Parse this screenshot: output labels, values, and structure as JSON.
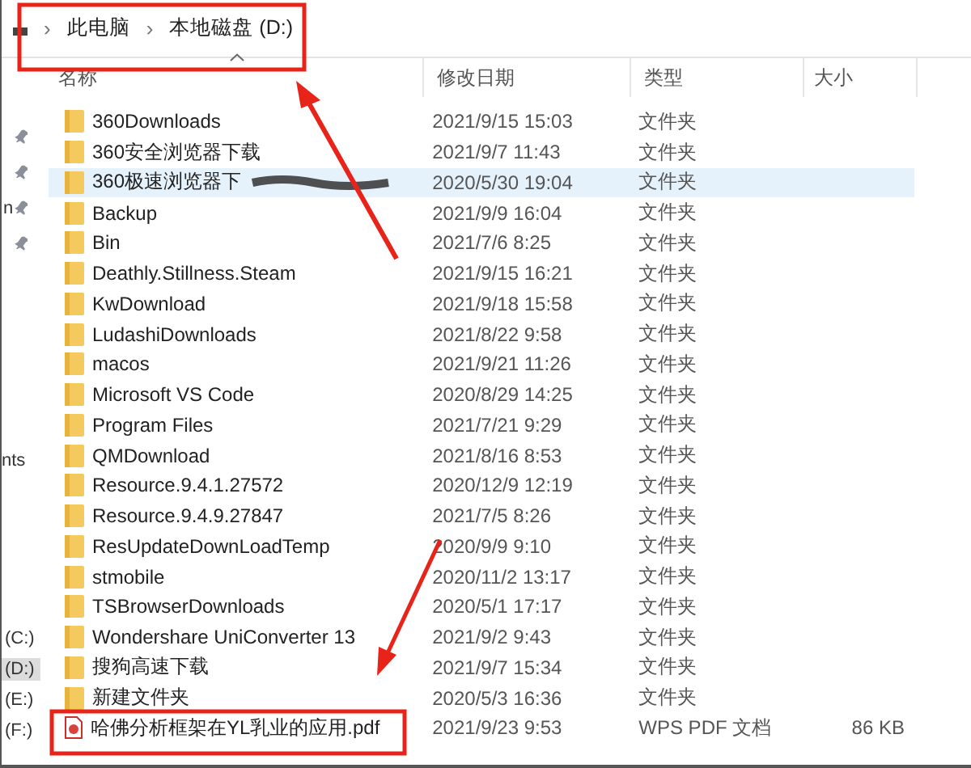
{
  "breadcrumb": [
    {
      "kind": "separator",
      "text": "›"
    },
    {
      "kind": "crumb",
      "text": "此电脑"
    },
    {
      "kind": "separator",
      "text": "›"
    },
    {
      "kind": "crumb",
      "text": "本地磁盘 (D:)"
    }
  ],
  "sidebar": {
    "quick_access": [
      {
        "pinned": true
      },
      {
        "pinned": true
      },
      {
        "pinned": true,
        "text": "n"
      },
      {
        "pinned": true
      }
    ],
    "label": "nts",
    "drives": [
      {
        "label": "(C:)",
        "selected": false
      },
      {
        "label": "(D:)",
        "selected": true
      },
      {
        "label": "(E:)",
        "selected": false
      },
      {
        "label": "(F:)",
        "selected": false
      }
    ]
  },
  "table": {
    "columns": [
      "名称",
      "修改日期",
      "类型",
      "大小"
    ],
    "rows": [
      {
        "kind": "folder",
        "name": "360Downloads",
        "date": "2021/9/15 15:03",
        "type": "文件夹",
        "selected": false
      },
      {
        "kind": "folder",
        "name": "360安全浏览器下载",
        "date": "2021/9/7 11:43",
        "type": "文件夹",
        "selected": false
      },
      {
        "kind": "folder",
        "name": "360极速浏览器下",
        "redacted": true,
        "date": "2020/5/30 19:04",
        "type": "文件夹",
        "selected": true
      },
      {
        "kind": "folder",
        "name": "Backup",
        "date": "2021/9/9 16:04",
        "type": "文件夹",
        "selected": false
      },
      {
        "kind": "folder",
        "name": "Bin",
        "date": "2021/7/6 8:25",
        "type": "文件夹",
        "selected": false
      },
      {
        "kind": "folder",
        "name": "Deathly.Stillness.Steam",
        "date": "2021/9/15 16:21",
        "type": "文件夹",
        "selected": false
      },
      {
        "kind": "folder",
        "name": "KwDownload",
        "date": "2021/9/18 15:58",
        "type": "文件夹",
        "selected": false
      },
      {
        "kind": "folder",
        "name": "LudashiDownloads",
        "date": "2021/8/22 9:58",
        "type": "文件夹",
        "selected": false
      },
      {
        "kind": "folder",
        "name": "macos",
        "date": "2021/9/21 11:26",
        "type": "文件夹",
        "selected": false
      },
      {
        "kind": "folder",
        "name": "Microsoft VS Code",
        "date": "2020/8/29 14:25",
        "type": "文件夹",
        "selected": false
      },
      {
        "kind": "folder",
        "name": "Program Files",
        "date": "2021/7/21 9:29",
        "type": "文件夹",
        "selected": false
      },
      {
        "kind": "folder",
        "name": "QMDownload",
        "date": "2021/8/16 8:53",
        "type": "文件夹",
        "selected": false
      },
      {
        "kind": "folder",
        "name": "Resource.9.4.1.27572",
        "date": "2020/12/9 12:19",
        "type": "文件夹",
        "selected": false
      },
      {
        "kind": "folder",
        "name": "Resource.9.4.9.27847",
        "date": "2021/7/5 8:26",
        "type": "文件夹",
        "selected": false
      },
      {
        "kind": "folder",
        "name": "ResUpdateDownLoadTemp",
        "date": "2020/9/9 9:10",
        "type": "文件夹",
        "selected": false
      },
      {
        "kind": "folder",
        "name": "stmobile",
        "date": "2020/11/2 13:17",
        "type": "文件夹",
        "selected": false
      },
      {
        "kind": "folder",
        "name": "TSBrowserDownloads",
        "date": "2020/5/1 17:17",
        "type": "文件夹",
        "selected": false
      },
      {
        "kind": "folder",
        "name": "Wondershare UniConverter 13",
        "date": "2021/9/2 9:43",
        "type": "文件夹",
        "selected": false
      },
      {
        "kind": "folder",
        "name": "搜狗高速下载",
        "date": "2021/9/7 15:34",
        "type": "文件夹",
        "selected": false
      },
      {
        "kind": "folder",
        "name": "新建文件夹",
        "date": "2020/5/3 16:36",
        "type": "文件夹",
        "selected": false
      },
      {
        "kind": "pdf",
        "name": "哈佛分析框架在YL乳业的应用.pdf",
        "date": "2021/9/23 9:53",
        "type": "WPS PDF 文档",
        "size": "86 KB",
        "selected": false
      }
    ]
  }
}
